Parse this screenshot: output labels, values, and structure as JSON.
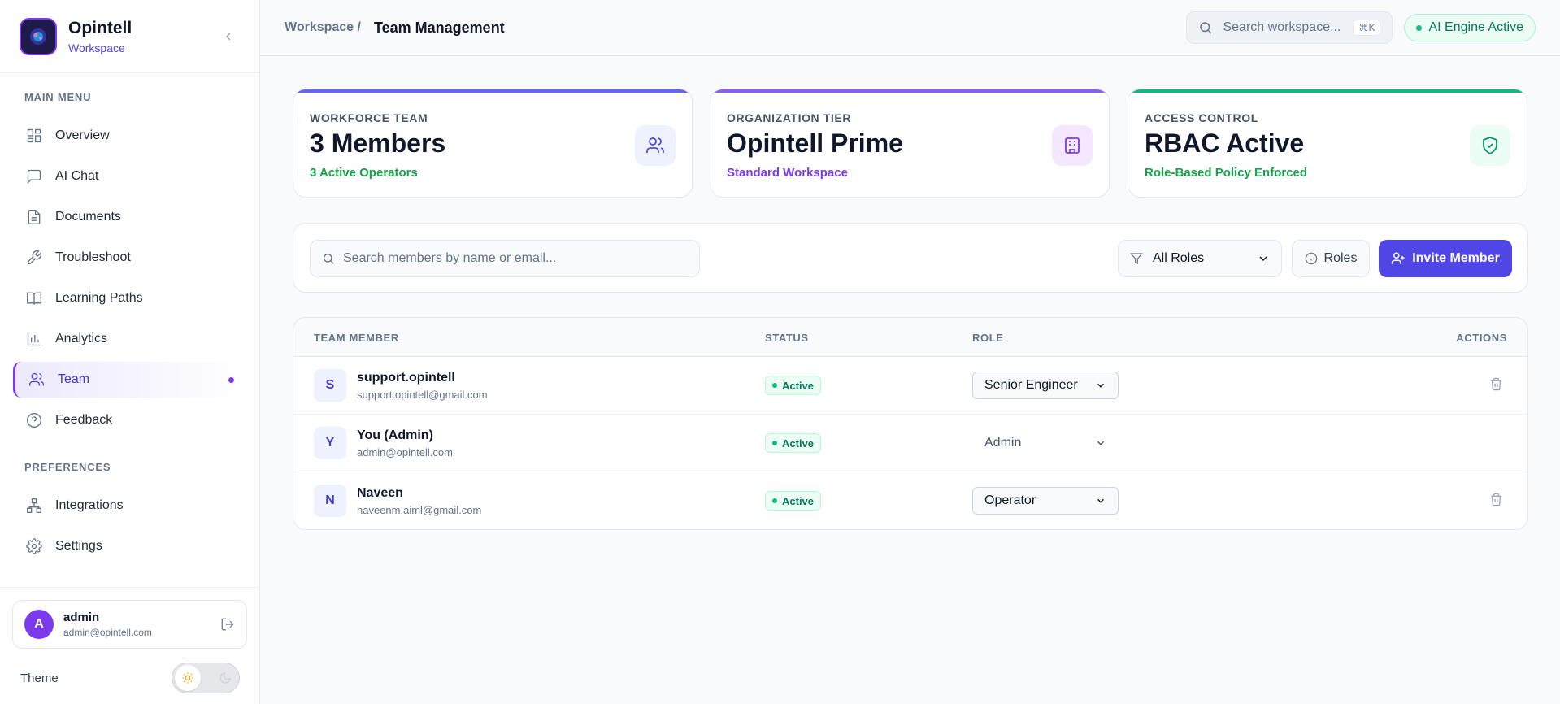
{
  "brand": {
    "name": "Opintell",
    "subtitle": "Workspace"
  },
  "sidebar": {
    "main_heading": "MAIN MENU",
    "items": [
      {
        "label": "Overview",
        "icon": "grid-icon"
      },
      {
        "label": "AI Chat",
        "icon": "chat-icon"
      },
      {
        "label": "Documents",
        "icon": "document-icon"
      },
      {
        "label": "Troubleshoot",
        "icon": "wrench-icon"
      },
      {
        "label": "Learning Paths",
        "icon": "book-icon"
      },
      {
        "label": "Analytics",
        "icon": "bar-chart-icon"
      },
      {
        "label": "Team",
        "icon": "users-icon",
        "active": true
      },
      {
        "label": "Feedback",
        "icon": "help-circle-icon"
      }
    ],
    "pref_heading": "PREFERENCES",
    "pref_items": [
      {
        "label": "Integrations",
        "icon": "network-icon"
      },
      {
        "label": "Settings",
        "icon": "gear-icon"
      }
    ],
    "user": {
      "initial": "A",
      "name": "admin",
      "email": "admin@opintell.com"
    },
    "theme_label": "Theme"
  },
  "header": {
    "breadcrumb_parent": "Workspace /",
    "breadcrumb_current": "Team Management",
    "search_placeholder": "Search workspace...",
    "search_shortcut": "⌘K",
    "engine_status": "AI Engine Active"
  },
  "stats": [
    {
      "label": "WORKFORCE TEAM",
      "value": "3 Members",
      "sub": "3 Active Operators",
      "accent": "#6366f1",
      "sub_color": "#16a34a",
      "icon": "users-icon"
    },
    {
      "label": "ORGANIZATION TIER",
      "value": "Opintell Prime",
      "sub": "Standard Workspace",
      "accent": "#8b5cf6",
      "sub_color": "#7c3aed",
      "icon": "building-icon"
    },
    {
      "label": "ACCESS CONTROL",
      "value": "RBAC Active",
      "sub": "Role-Based Policy Enforced",
      "accent": "#10b981",
      "sub_color": "#16a34a",
      "icon": "shield-check-icon"
    }
  ],
  "toolbar": {
    "search_placeholder": "Search members by name or email...",
    "role_filter": "All Roles",
    "roles_button": "Roles",
    "invite_button": "Invite Member"
  },
  "table": {
    "columns": [
      "TEAM MEMBER",
      "STATUS",
      "ROLE",
      "ACTIONS"
    ],
    "rows": [
      {
        "initial": "S",
        "name": "support.opintell",
        "email": "support.opintell@gmail.com",
        "status": "Active",
        "role": "Senior Engineer",
        "deletable": true
      },
      {
        "initial": "Y",
        "name": "You (Admin)",
        "email": "admin@opintell.com",
        "status": "Active",
        "role": "Admin",
        "deletable": false
      },
      {
        "initial": "N",
        "name": "Naveen",
        "email": "naveenm.aiml@gmail.com",
        "status": "Active",
        "role": "Operator",
        "deletable": true
      }
    ]
  }
}
